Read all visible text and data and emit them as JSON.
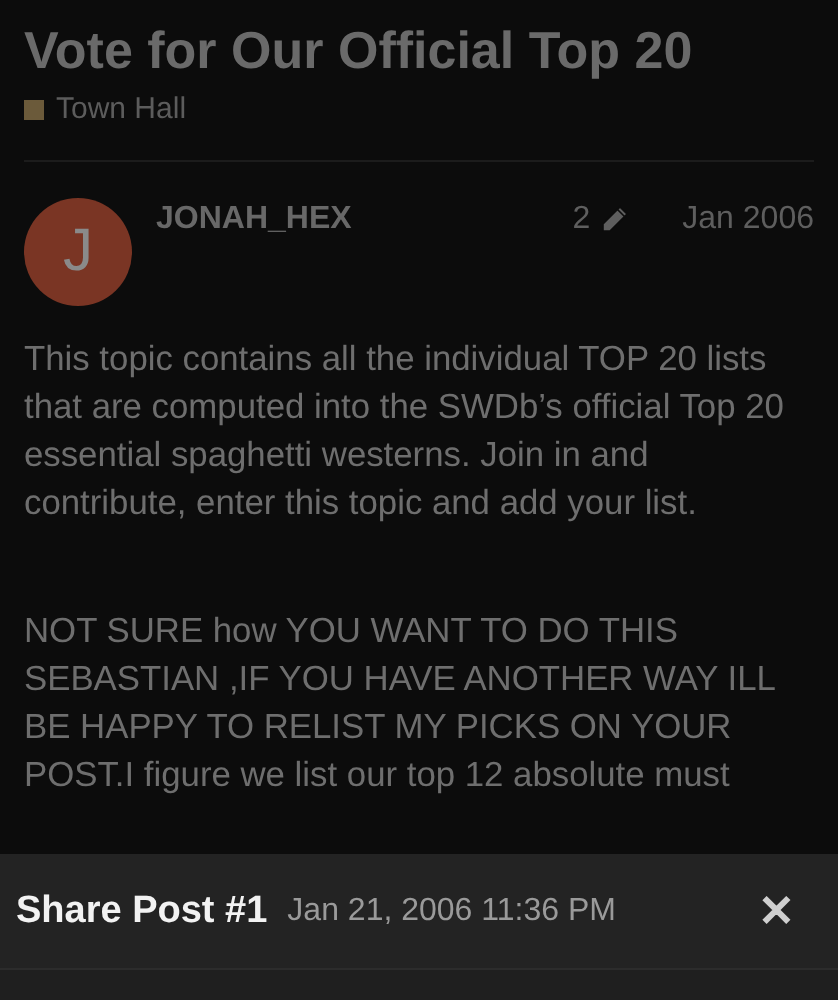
{
  "topic": {
    "title": "Vote for Our Official Top 20",
    "category": {
      "name": "Town Hall",
      "color": "#6b5a3a"
    }
  },
  "post": {
    "avatar": {
      "letter": "J",
      "color": "#7a3524"
    },
    "username": "JONAH_HEX",
    "edit_count": "2",
    "date": "Jan 2006",
    "paragraphs": [
      "This topic contains all the individual TOP 20 lists that are computed into the SWDb’s official Top 20 essential spaghetti westerns. Join in and contribute, enter this topic and add your list.",
      "NOT SURE how YOU WANT TO DO THIS SEBASTIAN ,IF YOU HAVE ANOTHER WAY ILL BE HAPPY TO RELIST MY PICKS ON YOUR POST.I figure we list our top 12 absolute must"
    ]
  },
  "share_sheet": {
    "title": "Share Post #1",
    "timestamp": "Jan 21, 2006 11:36 PM",
    "close": "✕"
  }
}
